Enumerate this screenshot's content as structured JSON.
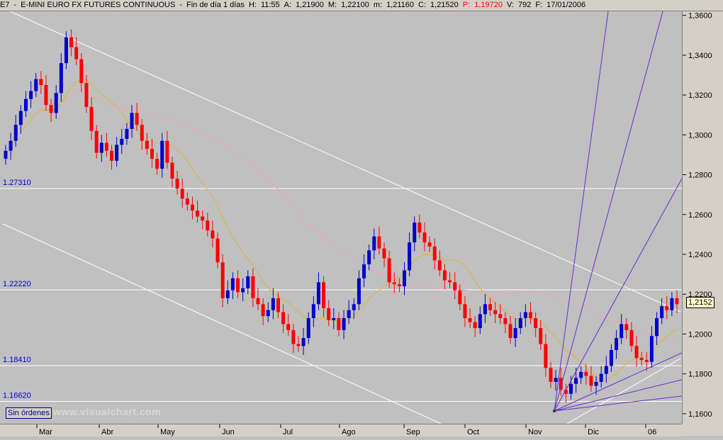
{
  "header": {
    "symbol": "E7",
    "name": "E-MINI EURO FX FUTURES CONTINUOUS",
    "period": "Fin de día 1 días",
    "high_label": "H:",
    "time": "11:55",
    "a_label": "A:",
    "a_value": "1,21900",
    "m_label": "M:",
    "m_value": "1,22100",
    "min_label": "m:",
    "min_value": "1,21160",
    "c_label": "C:",
    "c_value": "1,21520",
    "p_label": "P:",
    "p_value": "1,19720",
    "v_label": "V:",
    "v_value": "792",
    "f_label": "F:",
    "f_value": "17/01/2006"
  },
  "chart_data": {
    "type": "candlestick",
    "x_labels": [
      "Mar",
      "Abr",
      "May",
      "Jun",
      "Jul",
      "Ago",
      "Sep",
      "Oct",
      "Nov",
      "Dic",
      "06"
    ],
    "y_ticks": [
      "1,3600",
      "1,3400",
      "1,3200",
      "1,3000",
      "1,2800",
      "1,2600",
      "1,2400",
      "1,2200",
      "1,2000",
      "1,1800",
      "1,1600"
    ],
    "ylim": [
      1.155,
      1.362
    ],
    "horizontal_levels": [
      {
        "label": "1.27310",
        "value": 1.2731
      },
      {
        "label": "1.22220",
        "value": 1.2222
      },
      {
        "label": "1.18410",
        "value": 1.1841
      },
      {
        "label": "1.16620",
        "value": 1.1662
      }
    ],
    "last_price": "1,2152",
    "closes": [
      1.292,
      1.297,
      1.305,
      1.312,
      1.318,
      1.322,
      1.328,
      1.325,
      1.315,
      1.311,
      1.321,
      1.336,
      1.349,
      1.344,
      1.338,
      1.326,
      1.314,
      1.302,
      1.291,
      1.296,
      1.292,
      1.287,
      1.295,
      1.298,
      1.303,
      1.311,
      1.305,
      1.297,
      1.293,
      1.288,
      1.283,
      1.297,
      1.286,
      1.278,
      1.273,
      1.268,
      1.265,
      1.262,
      1.259,
      1.257,
      1.252,
      1.248,
      1.236,
      1.218,
      1.222,
      1.228,
      1.221,
      1.223,
      1.229,
      1.218,
      1.215,
      1.209,
      1.212,
      1.218,
      1.211,
      1.205,
      1.202,
      1.195,
      1.194,
      1.198,
      1.208,
      1.215,
      1.226,
      1.213,
      1.207,
      1.208,
      1.202,
      1.208,
      1.212,
      1.215,
      1.228,
      1.235,
      1.242,
      1.249,
      1.243,
      1.238,
      1.226,
      1.225,
      1.224,
      1.232,
      1.246,
      1.256,
      1.251,
      1.246,
      1.244,
      1.237,
      1.232,
      1.227,
      1.226,
      1.222,
      1.215,
      1.208,
      1.206,
      1.203,
      1.21,
      1.215,
      1.212,
      1.21,
      1.208,
      1.205,
      1.198,
      1.203,
      1.208,
      1.211,
      1.208,
      1.203,
      1.195,
      1.183,
      1.176,
      1.178,
      1.172,
      1.17,
      1.175,
      1.178,
      1.181,
      1.179,
      1.174,
      1.176,
      1.18,
      1.184,
      1.192,
      1.198,
      1.205,
      1.202,
      1.194,
      1.188,
      1.187,
      1.186,
      1.199,
      1.208,
      1.214,
      1.212,
      1.218,
      1.215
    ]
  },
  "footer": {
    "orders_button": "Sin órdenes",
    "watermark": "www.visualchart.com"
  },
  "colors": {
    "background": "#c0c0c0",
    "up": "#0000cc",
    "down": "#ff0000",
    "ma_short": "#d8b840",
    "ma_long": "#e8a8b8",
    "fan": "#6a2bd0",
    "trend": "#ffffff"
  }
}
